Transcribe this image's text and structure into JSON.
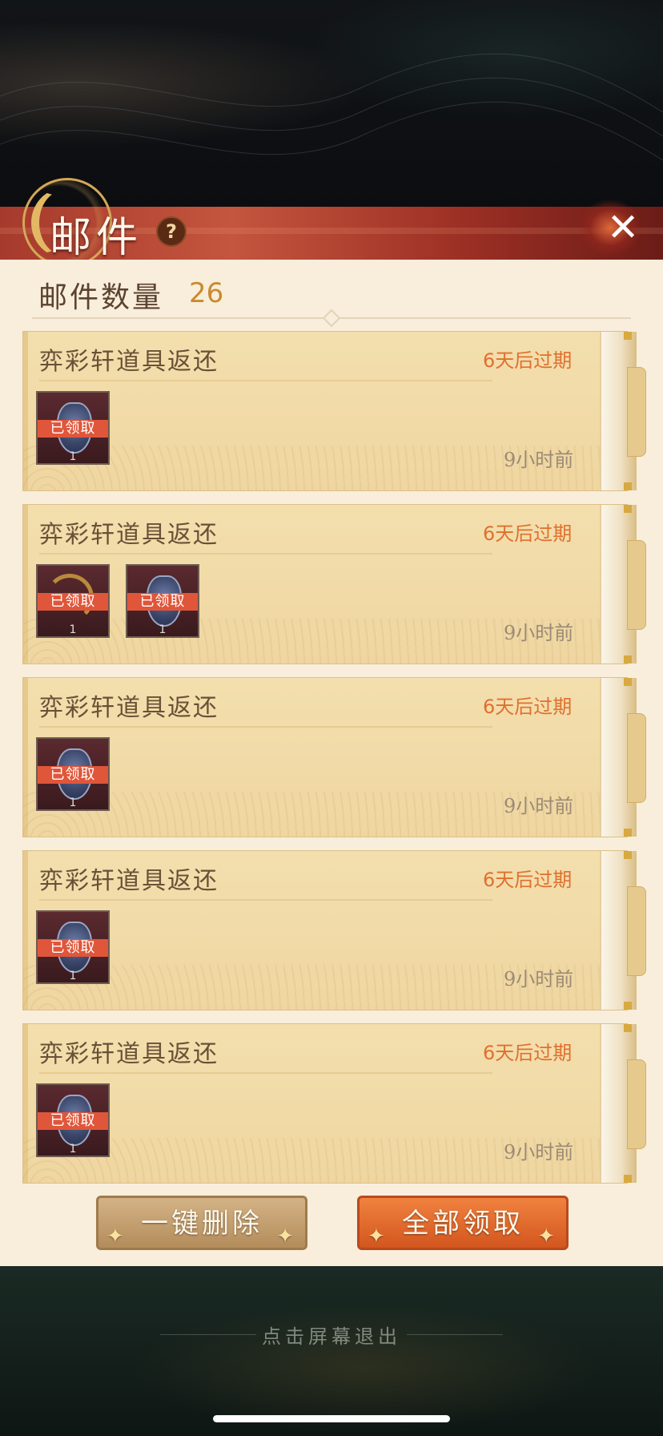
{
  "header": {
    "title": "邮件",
    "help": "?",
    "close": "✕"
  },
  "mailbox": {
    "count_label": "邮件数量",
    "count": "26"
  },
  "mails": [
    {
      "title": "弈彩轩道具返还",
      "expire": "6天后过期",
      "time": "9小时前",
      "items": [
        {
          "status": "已领取",
          "qty": "1"
        }
      ]
    },
    {
      "title": "弈彩轩道具返还",
      "expire": "6天后过期",
      "time": "9小时前",
      "items": [
        {
          "status": "已领取",
          "qty": "1"
        },
        {
          "status": "已领取",
          "qty": "1"
        }
      ]
    },
    {
      "title": "弈彩轩道具返还",
      "expire": "6天后过期",
      "time": "9小时前",
      "items": [
        {
          "status": "已领取",
          "qty": "1"
        }
      ]
    },
    {
      "title": "弈彩轩道具返还",
      "expire": "6天后过期",
      "time": "9小时前",
      "items": [
        {
          "status": "已领取",
          "qty": "1"
        }
      ]
    },
    {
      "title": "弈彩轩道具返还",
      "expire": "6天后过期",
      "time": "9小时前",
      "items": [
        {
          "status": "已领取",
          "qty": "1"
        }
      ]
    }
  ],
  "buttons": {
    "delete_all": "一键删除",
    "claim_all": "全部领取",
    "deco": "✦"
  },
  "footer": {
    "exit_hint": "点击屏幕退出"
  },
  "colors": {
    "header_red": "#a63a2c",
    "expire_orange": "#e0702f",
    "claimed_red": "#e0563a",
    "count_gold": "#c98a2f"
  }
}
